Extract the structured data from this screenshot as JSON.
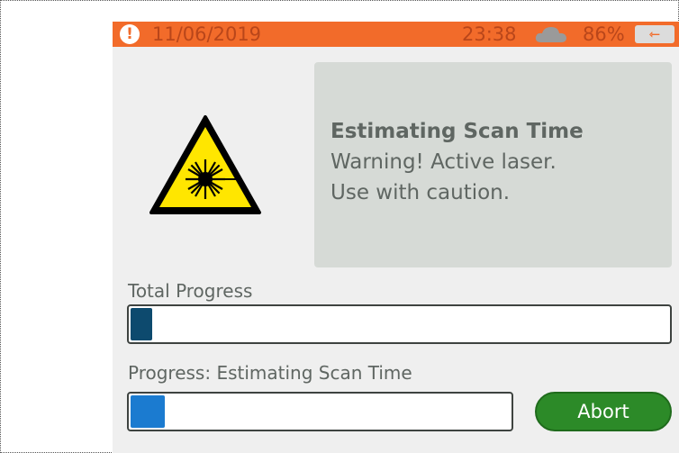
{
  "status_bar": {
    "alert_icon": "exclamation-circle-icon",
    "alert_glyph": "!",
    "date": "11/06/2019",
    "time": "23:38",
    "cloud_icon": "cloud-icon",
    "battery": "86%",
    "plug_icon": "charging-plug-icon",
    "plug_glyph": "⇽",
    "color": "#f26b2a"
  },
  "warning_panel": {
    "icon": "laser-warning-icon",
    "title": "Estimating Scan Time",
    "line1": "Warning! Active laser.",
    "line2": "Use with caution."
  },
  "total_progress": {
    "label": "Total Progress",
    "value": 0.04,
    "fill_color": "#0d4a6e"
  },
  "step_progress": {
    "label": "Progress: Estimating Scan Time",
    "value": 0.09,
    "fill_color": "#1b7bd0"
  },
  "abort_button": {
    "label": "Abort",
    "color": "#2c8a28"
  }
}
